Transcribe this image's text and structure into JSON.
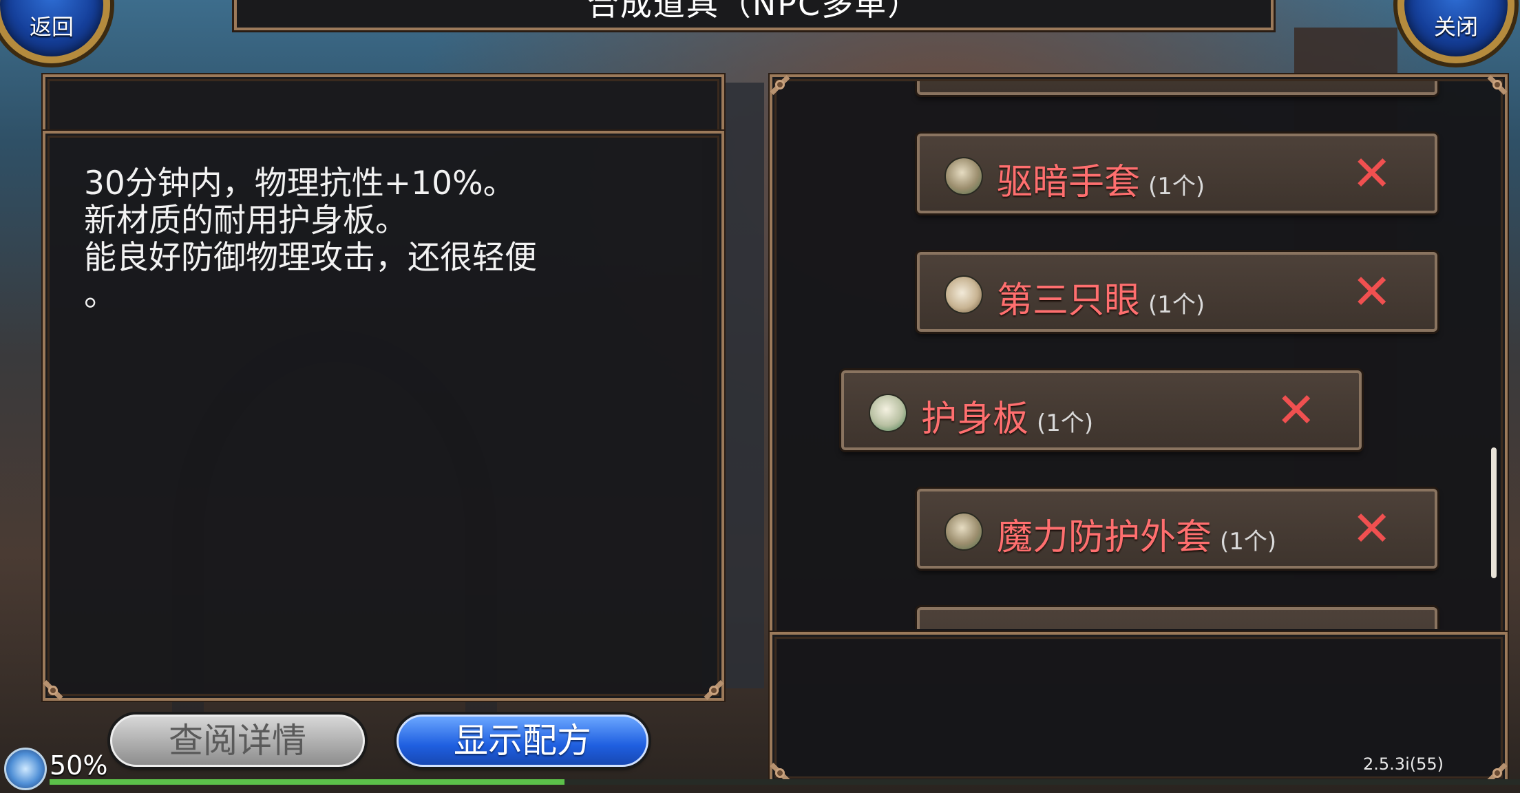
{
  "title": "合成道具（NPC多单）",
  "buttons": {
    "back": "返回",
    "close": "关闭",
    "detail": "查阅详情",
    "recipe": "显示配方"
  },
  "description": "30分钟内，物理抗性+10%。\n新材质的耐用护身板。\n能良好防御物理攻击，还很轻便\n。",
  "items": [
    {
      "name": "驱暗手套",
      "qty": "(1个)",
      "icon": "package-icon"
    },
    {
      "name": "第三只眼",
      "qty": "(1个)",
      "icon": "pouch-icon"
    },
    {
      "name": "护身板",
      "qty": "(1个)",
      "icon": "scroll-icon"
    },
    {
      "name": "魔力防护外套",
      "qty": "(1个)",
      "icon": "package-icon"
    }
  ],
  "remove_symbol": "✕",
  "status": {
    "percent": "50%",
    "progress": 0.35,
    "version": "2.5.3i(55)"
  },
  "colors": {
    "item_name": "#ff6f6f",
    "remove": "#f05050",
    "recipe_button": "#1f5fe0",
    "progress": "#5cc04a"
  }
}
